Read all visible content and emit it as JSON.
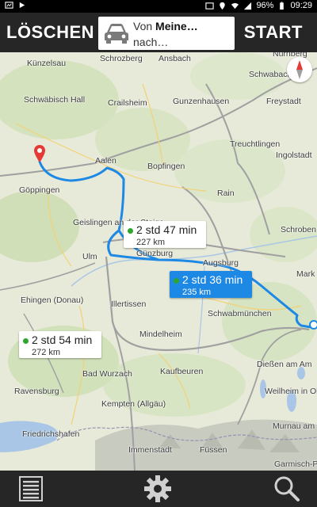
{
  "status_bar": {
    "battery": "96%",
    "time": "09:29"
  },
  "topbar": {
    "clear_label": "LÖSCHEN",
    "start_label": "START",
    "route_from_prefix": "Von",
    "route_from": "Meine…",
    "route_to": "nach…",
    "icon": "car-icon"
  },
  "map": {
    "towns": {
      "kunzelsau": "Künzelsau",
      "schrozberg": "Schrozberg",
      "ansbach": "Ansbach",
      "nurnberg": "Nürnberg",
      "schwabach": "Schwabach",
      "schwabisch_hall": "Schwäbisch Hall",
      "crailsheim": "Crailsheim",
      "gunzenhausen": "Gunzenhausen",
      "freystadt": "Freystadt",
      "treuchtlingen": "Treuchtlingen",
      "aalen": "Aalen",
      "bopfingen": "Bopfingen",
      "ingolstadt": "Ingolstadt",
      "goppingen": "Göppingen",
      "rain": "Rain",
      "geislingen": "Geislingen an der Steige",
      "schroben": "Schroben",
      "ulm": "Ulm",
      "gunzburg": "Günzburg",
      "augsburg": "Augsburg",
      "ehingen": "Ehingen (Donau)",
      "mark": "Mark",
      "illertissen": "Illertissen",
      "schwabmunchen": "Schwabmünchen",
      "mindelheim": "Mindelheim",
      "bad_wurzach": "Bad Wurzach",
      "kaufbeuren": "Kaufbeuren",
      "diessen": "Dießen am Am",
      "ravensburg": "Ravensburg",
      "weilheim": "Weilheim in Ober",
      "kempten": "Kempten (Allgäu)",
      "friedrichshafen": "Friedrichshafen",
      "murnau": "Murnau am",
      "immenstadt": "Immenstadt",
      "fussen": "Füssen",
      "garmisch": "Garmisch-Pa"
    },
    "routes": [
      {
        "time": "2 std 47 min",
        "distance": "227 km",
        "selected": false,
        "color": "#2ea52e"
      },
      {
        "time": "2 std 36 min",
        "distance": "235 km",
        "selected": true,
        "color": "#1e88e5"
      },
      {
        "time": "2 std 54 min",
        "distance": "272 km",
        "selected": false,
        "color": "#2ea52e"
      }
    ],
    "compass_icon": "compass-icon",
    "marker_icon": "location-pin-icon"
  },
  "bottombar": {
    "icons": [
      "list-icon",
      "gear-icon",
      "search-icon"
    ]
  }
}
